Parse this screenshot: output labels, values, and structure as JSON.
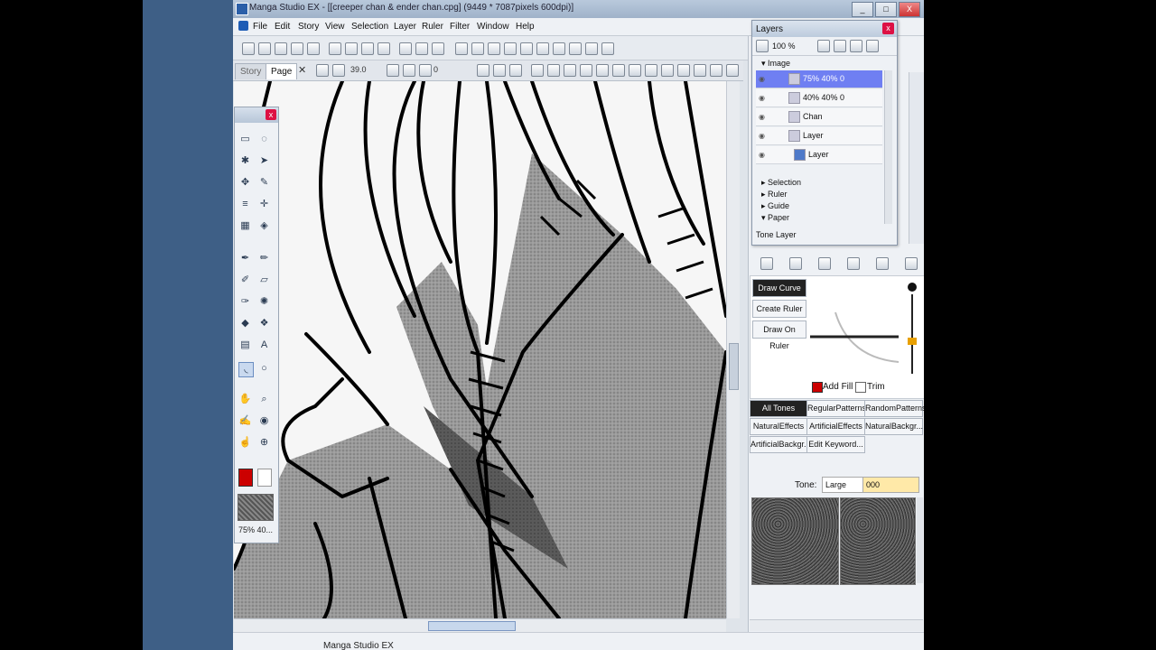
{
  "window": {
    "title": "Manga Studio EX - [[creeper chan & ender chan.cpg] (9449 * 7087pixels 600dpi)]",
    "controls": [
      "_",
      "□",
      "X"
    ]
  },
  "menu": [
    "File",
    "Edit",
    "Story",
    "View",
    "Selection",
    "Layer",
    "Ruler",
    "Filter",
    "Window",
    "Help"
  ],
  "tabs": {
    "story": "Story",
    "page": "Page",
    "close": "✕"
  },
  "canvas_toolbar": {
    "zoom": "39.0",
    "angle": "0"
  },
  "toolbox": {
    "close": "x",
    "current_tone_label": "75% 40..."
  },
  "layers": {
    "title": "Layers",
    "close": "x",
    "opacity": "100 %",
    "folder_image": "Image",
    "rows": [
      {
        "name": "75% 40% 0",
        "selected": true
      },
      {
        "name": "40% 40% 0",
        "selected": false
      },
      {
        "name": "Chan",
        "selected": false
      },
      {
        "name": "Layer",
        "selected": false
      },
      {
        "name": "Layer",
        "selected": false
      }
    ],
    "folders": [
      "Selection",
      "Ruler",
      "Guide",
      "Paper"
    ],
    "footer": "Tone Layer"
  },
  "ruler_panel": {
    "buttons": [
      "Draw Curve",
      "Create Ruler",
      "Draw On Ruler"
    ],
    "add_fill": "Add Fill",
    "trim": "Trim"
  },
  "tone_tabs": [
    "All Tones",
    "RegularPatterns",
    "RandomPatterns",
    "NaturalEffects",
    "ArtificialEffects",
    "NaturalBackgr...",
    "ArtificialBackgr...",
    "Edit Keyword..."
  ],
  "tone_filter": {
    "label": "Tone:",
    "size": "Large",
    "value": "000"
  },
  "status": {
    "text": "Manga Studio EX"
  }
}
